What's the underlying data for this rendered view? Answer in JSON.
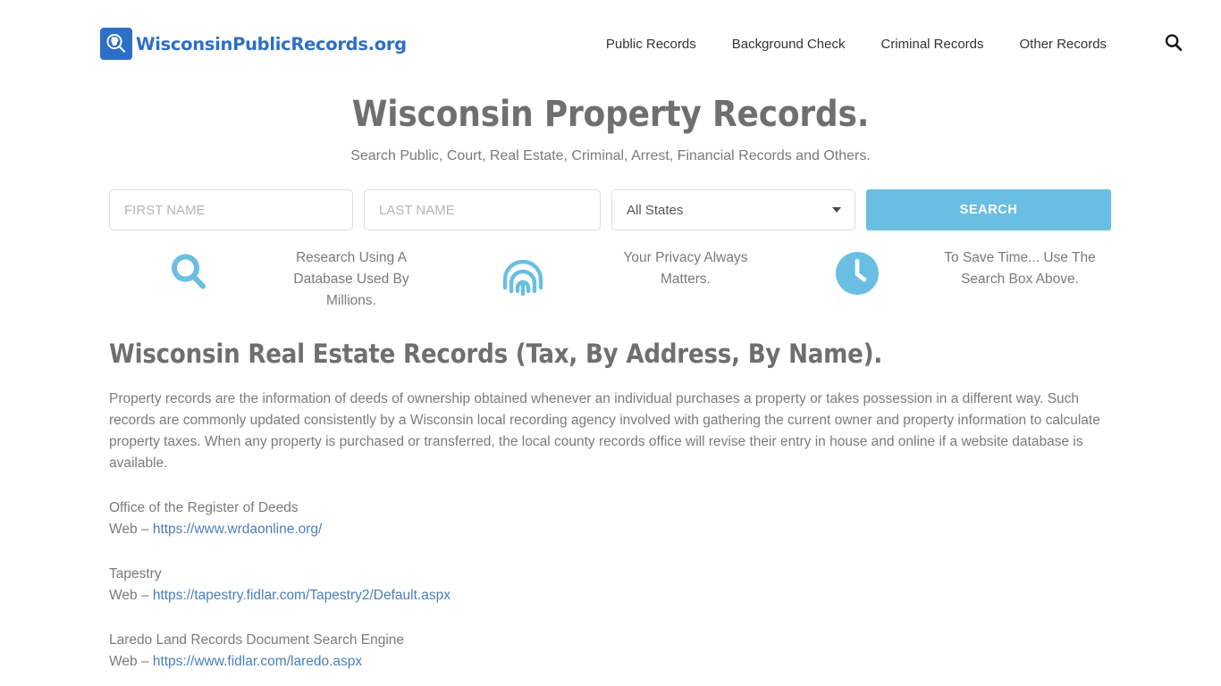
{
  "header": {
    "brand_name": "WisconsinPublicRecords.org",
    "brand_icon": "magnifier-wisconsin-icon",
    "nav": [
      {
        "label": "Public Records"
      },
      {
        "label": "Background Check"
      },
      {
        "label": "Criminal Records"
      },
      {
        "label": "Other Records"
      }
    ],
    "search_icon": "search-icon"
  },
  "hero": {
    "title": "Wisconsin Property Records.",
    "subtitle": "Search Public, Court, Real Estate, Criminal, Arrest, Financial Records and Others."
  },
  "search_form": {
    "first_name_placeholder": "FIRST NAME",
    "first_name_value": "",
    "last_name_placeholder": "LAST NAME",
    "last_name_value": "",
    "state_selected": "All States",
    "submit_label": "SEARCH",
    "accent_color": "#6ABEE2"
  },
  "features": [
    {
      "icon": "search-icon",
      "text": "Research Using A Database Used By Millions."
    },
    {
      "icon": "fingerprint-icon",
      "text": "Your Privacy Always Matters."
    },
    {
      "icon": "clock-icon",
      "text": "To Save Time... Use The Search Box Above."
    }
  ],
  "article": {
    "title": "Wisconsin Real Estate Records (Tax, By Address, By Name).",
    "paragraph": "Property records are the information of deeds of ownership obtained whenever an individual purchases a property or takes possession in a different way. Such records are commonly updated consistently by a Wisconsin local recording agency involved with gathering the current owner and property information to calculate property taxes. When any property is purchased or transferred, the local county records office will revise their entry in house and online if a website database is available.",
    "resources": [
      {
        "name": "Office of the Register of Deeds",
        "label": "Web – ",
        "url_text": "https://www.wrdaonline.org/"
      },
      {
        "name": "Tapestry",
        "label": "Web – ",
        "url_text": "https://tapestry.fidlar.com/Tapestry2/Default.aspx"
      },
      {
        "name": "Laredo Land Records Document Search Engine",
        "label": "Web – ",
        "url_text": "https://www.fidlar.com/laredo.aspx"
      }
    ]
  },
  "colors": {
    "brand_blue": "#2D6FC4",
    "accent_blue": "#6ABEE2",
    "link_blue": "#4A7EBB",
    "heading_gray": "#6F6F6F",
    "body_gray": "#7B7B7B"
  }
}
